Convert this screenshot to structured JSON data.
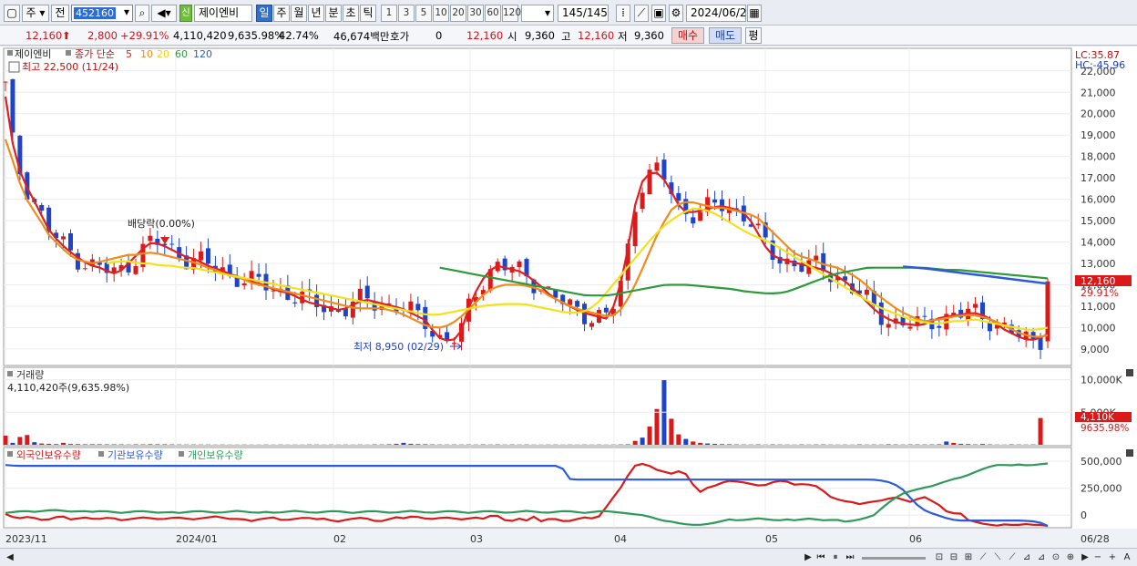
{
  "toolbar": {
    "period_week": "주",
    "prev_label": "전",
    "stock_code": "452160",
    "new_badge": "신",
    "stock_name": "제이엔비",
    "period_tabs": [
      "일",
      "주",
      "월",
      "년",
      "분",
      "초",
      "틱"
    ],
    "active_tab": "일",
    "intervals": [
      "1",
      "3",
      "5",
      "10",
      "20",
      "30",
      "60",
      "120"
    ],
    "count": "145/145",
    "date": "2024/06/28"
  },
  "quote": {
    "price": "12,160",
    "change": "2,800",
    "change_pct": "+29.91%",
    "volume": "4,110,420",
    "volume_ratio": "9,635.98%",
    "turnover": "42.74%",
    "amount": "46,674백만",
    "hoga_label": "호가",
    "hoga_value": "0",
    "hoga_price": "12,160",
    "open_label": "시",
    "open": "9,360",
    "high_label": "고",
    "high": "12,160",
    "low_label": "저",
    "low": "9,360",
    "buy": "매수",
    "sell": "매도",
    "eval": "평"
  },
  "price_panel": {
    "stock_label": "제이엔비",
    "ma_label": "종가 단순",
    "ma_periods": [
      "5",
      "10",
      "20",
      "60",
      "120"
    ],
    "ma_colors": [
      "#e02020",
      "#f08c1c",
      "#f0e21c",
      "#2d9a3a",
      "#2d5ad8"
    ],
    "high_note": "최고 22,500 (11/24)",
    "low_note": "최저 8,950 (02/29)",
    "dividend_note": "배당락(0.00%)",
    "lc": "LC:35.87",
    "hc": "HC:-45.96",
    "last_price_tag": "12,160",
    "last_pct_tag": "29.91%"
  },
  "volume_panel": {
    "title": "거래량",
    "summary": "4,110,420주(9,635.98%)",
    "tag_value": "4,110K",
    "tag_pct": "9635.98%"
  },
  "holding_panel": {
    "series": [
      "외국인보유수량",
      "기관보유수량",
      "개인보유수량"
    ],
    "colors": [
      "#d91a1a",
      "#2d5ad8",
      "#2e9a5a"
    ]
  },
  "x_axis_labels": [
    "2023/11",
    "2024/01",
    "02",
    "03",
    "04",
    "05",
    "06",
    "06/28"
  ],
  "chart_data": [
    {
      "type": "candlestick",
      "title": "제이엔비 일봉",
      "x": [
        "2023/11",
        "2024/01",
        "02",
        "03",
        "04",
        "05",
        "06"
      ],
      "y_ticks": [
        9000,
        10000,
        11000,
        12000,
        13000,
        14000,
        15000,
        16000,
        17000,
        18000,
        19000,
        20000,
        21000,
        22000
      ],
      "ylim": [
        8400,
        22800
      ],
      "series": [
        {
          "name": "5",
          "values": [
            20800,
            18200,
            16900,
            16200,
            15400,
            14600,
            14100,
            13700,
            13400,
            13100,
            12900,
            12800,
            12600,
            12500,
            12900,
            13300,
            13700,
            14000,
            13900,
            13700,
            13500,
            13300,
            13200,
            13000,
            12800,
            12700,
            12500,
            12400,
            12200,
            12100,
            12000,
            11800,
            11700,
            11600,
            11400,
            11200,
            11100,
            11000,
            10900,
            10800,
            11000,
            11200,
            11300,
            11200,
            11100,
            11000,
            10900,
            10700,
            10500,
            10300,
            9600,
            9400,
            9400,
            9900,
            11200,
            12000,
            12600,
            12900,
            12800,
            12700,
            12600,
            12300,
            12000,
            11600,
            11300,
            11100,
            10900,
            10700,
            10600,
            10500,
            10400,
            11400,
            13000,
            15600,
            16900,
            17300,
            17200,
            16600,
            15800,
            15400,
            15400,
            15500,
            15600,
            15700,
            15600,
            15500,
            15300,
            14700,
            13900,
            13400,
            13200,
            13100,
            13000,
            12900,
            12800,
            12700,
            12500,
            12300,
            12000,
            11600,
            11200,
            10800,
            10500,
            10300,
            10200,
            10150,
            10100,
            10200,
            10400,
            10500,
            10550,
            10600,
            10700,
            10650,
            10500,
            10200,
            9900,
            9700,
            9500,
            9400,
            9500,
            9700
          ]
        },
        {
          "name": "10",
          "values": [
            18800,
            17600,
            16300,
            15600,
            15000,
            14300,
            13900,
            13500,
            13200,
            13100,
            13000,
            13100,
            13200,
            13300,
            13400,
            13400,
            13500,
            13500,
            13400,
            13300,
            13200,
            13100,
            13000,
            12800,
            12700,
            12500,
            12400,
            12300,
            12100,
            12000,
            11900,
            11800,
            11700,
            11600,
            11500,
            11400,
            11300,
            11200,
            11100,
            11000,
            10900,
            10900,
            10900,
            10900,
            10800,
            10700,
            10500,
            10300,
            10100,
            10000,
            10000,
            10200,
            10500,
            10900,
            11300,
            11700,
            11900,
            12000,
            12000,
            12000,
            11900,
            11800,
            11500,
            11300,
            11100,
            10900,
            10800,
            10700,
            10600,
            10500,
            10700,
            11300,
            12100,
            13000,
            14000,
            14800,
            15500,
            15800,
            15900,
            15800,
            15700,
            15600,
            15600,
            15500,
            15400,
            15300,
            15100,
            14700,
            14300,
            13900,
            13500,
            13300,
            13200,
            13000,
            12900,
            12800,
            12600,
            12400,
            12100,
            11700,
            11400,
            11100,
            10800,
            10600,
            10400,
            10300,
            10350,
            10400,
            10500,
            10550,
            10600,
            10550,
            10450,
            10300,
            10100,
            9900,
            9700,
            9600,
            9550,
            9650
          ]
        },
        {
          "name": "20",
          "values": [
            13000,
            13100,
            13100,
            13000,
            13000,
            12900,
            12900,
            12800,
            12800,
            12700,
            12600,
            12500,
            12400,
            12300,
            12200,
            12100,
            12000,
            11900,
            11800,
            11700,
            11600,
            11500,
            11400,
            11300,
            11200,
            11100,
            11000,
            10900,
            10800,
            10700,
            10600,
            10600,
            10700,
            10800,
            10900,
            11000,
            11050,
            11100,
            11100,
            11100,
            11000,
            10900,
            10800,
            10700,
            10700,
            10800,
            11200,
            11800,
            12400,
            13000,
            13600,
            14200,
            14700,
            15100,
            15400,
            15600,
            15500,
            15300,
            15000,
            14700,
            14400,
            14200,
            14000,
            13700,
            13400,
            13100,
            12800,
            12500,
            12200,
            11900,
            11600,
            11300,
            11000,
            10800,
            10600,
            10400,
            10300,
            10200,
            10200,
            10300,
            10300,
            10400,
            10300,
            10200,
            10100,
            10000,
            9900,
            9900,
            10000
          ]
        },
        {
          "name": "60",
          "values": [
            12800,
            12700,
            12600,
            12500,
            12400,
            12300,
            12200,
            12100,
            12000,
            11900,
            11800,
            11700,
            11600,
            11500,
            11500,
            11500,
            11600,
            11700,
            11800,
            11900,
            12000,
            12000,
            12000,
            11950,
            11900,
            11850,
            11800,
            11700,
            11650,
            11600,
            11600,
            11700,
            11900,
            12100,
            12300,
            12500,
            12600,
            12700,
            12800,
            12800,
            12800,
            12800,
            12800,
            12800,
            12750,
            12700,
            12700,
            12650,
            12600,
            12550,
            12500,
            12450,
            12400,
            12350,
            12300
          ]
        },
        {
          "name": "120",
          "values": [
            12850,
            12820,
            12790,
            12750,
            12700,
            12650,
            12600,
            12550,
            12500,
            12450,
            12400,
            12350,
            12300,
            12250,
            12200,
            12150,
            12100,
            12060
          ]
        }
      ],
      "last_price": 12160,
      "high": {
        "value": 22500,
        "date": "11/24"
      },
      "low": {
        "value": 8950,
        "date": "02/29"
      }
    },
    {
      "type": "bar",
      "title": "거래량",
      "y_ticks": [
        "5,000K",
        "10,000K"
      ],
      "ylim": [
        0,
        10500
      ],
      "values_k": [
        1400,
        300,
        1200,
        1500,
        400,
        200,
        150,
        100,
        300,
        120,
        100,
        80,
        90,
        80,
        70,
        70,
        60,
        50,
        70,
        60,
        90,
        80,
        70,
        60,
        50,
        40,
        50,
        40,
        40,
        30,
        40,
        30,
        30,
        40,
        30,
        30,
        40,
        30,
        40,
        30,
        30,
        30,
        50,
        40,
        30,
        40,
        30,
        40,
        30,
        40,
        30,
        60,
        50,
        80,
        150,
        300,
        150,
        100,
        80,
        60,
        50,
        40,
        50,
        40,
        50,
        40,
        60,
        40,
        60,
        40,
        50,
        40,
        50,
        30,
        30,
        40,
        40,
        30,
        40,
        30,
        40,
        30,
        40,
        30,
        40,
        50,
        80,
        600,
        1100,
        2800,
        5500,
        10000,
        4000,
        1600,
        900,
        500,
        300,
        200,
        150,
        100,
        80,
        60,
        50,
        40,
        60,
        40,
        60,
        50,
        40,
        30,
        60,
        40,
        50,
        60,
        40,
        30,
        40,
        30,
        60,
        40,
        50,
        40,
        80,
        60,
        40,
        60,
        60,
        50,
        60,
        80,
        500,
        300,
        150,
        100,
        60,
        120,
        60,
        40,
        30,
        60,
        50,
        40,
        50,
        4110
      ]
    },
    {
      "type": "line",
      "title": "보유수량",
      "y_ticks": [
        "0",
        "250,000",
        "500,000"
      ],
      "ylim": [
        -100000,
        560000
      ],
      "series": [
        {
          "name": "외국인보유수량",
          "values": [
            10000,
            -20000,
            -30000,
            -10000,
            -40000,
            -50000,
            -20000,
            -10000,
            -40000,
            -30000,
            -20000,
            -40000,
            -30000,
            -20000,
            -50000,
            -40000,
            -30000,
            -20000,
            -30000,
            -40000,
            -30000,
            -20000,
            -30000,
            -40000,
            -30000,
            -20000,
            -10000,
            -30000,
            -40000,
            -30000,
            -60000,
            -40000,
            -30000,
            -20000,
            -50000,
            -40000,
            -30000,
            -20000,
            -40000,
            -30000,
            -50000,
            -60000,
            -40000,
            -30000,
            -20000,
            -50000,
            -60000,
            -40000,
            -20000,
            -30000,
            -10000,
            -20000,
            -40000,
            -30000,
            -20000,
            -30000,
            -40000,
            -30000,
            -20000,
            -40000,
            20000,
            -40000,
            -60000,
            -30000,
            -50000,
            -10000,
            -70000,
            -20000,
            -50000,
            -60000,
            -40000,
            -20000,
            -30000,
            -10000,
            100000,
            200000,
            300000,
            450000,
            480000,
            460000,
            420000,
            400000,
            380000,
            420000,
            350000,
            200000,
            250000,
            270000,
            300000,
            320000,
            310000,
            300000,
            280000,
            270000,
            300000,
            320000,
            310000,
            280000,
            290000,
            280000,
            260000,
            180000,
            150000,
            130000,
            120000,
            100000,
            120000,
            130000,
            140000,
            170000,
            150000,
            120000,
            150000,
            170000,
            120000,
            80000,
            0,
            40000,
            -40000,
            -60000,
            -80000,
            -90000,
            -100000,
            -80000,
            -100000,
            -80000,
            -90000,
            -90000,
            -100000
          ]
        },
        {
          "name": "기관보유수량",
          "values": [
            465000,
            458000,
            458000,
            458000,
            458000,
            458000,
            458000,
            458000,
            458000,
            458000,
            458000,
            458000,
            458000,
            458000,
            458000,
            458000,
            458000,
            458000,
            458000,
            458000,
            458000,
            458000,
            458000,
            458000,
            458000,
            458000,
            458000,
            458000,
            458000,
            458000,
            458000,
            458000,
            458000,
            458000,
            458000,
            458000,
            458000,
            458000,
            458000,
            458000,
            458000,
            458000,
            458000,
            458000,
            458000,
            458000,
            458000,
            458000,
            458000,
            458000,
            458000,
            458000,
            458000,
            458000,
            458000,
            458000,
            458000,
            458000,
            330000,
            330000,
            330000,
            330000,
            330000,
            330000,
            330000,
            330000,
            330000,
            330000,
            330000,
            330000,
            330000,
            330000,
            330000,
            330000,
            330000,
            330000,
            330000,
            330000,
            330000,
            330000,
            330000,
            330000,
            330000,
            330000,
            330000,
            330000,
            330000,
            330000,
            330000,
            330000,
            320000,
            300000,
            250000,
            150000,
            60000,
            20000,
            -10000,
            -40000,
            -50000,
            -50000,
            -50000,
            -50000,
            -50000,
            -50000,
            -50000,
            -55000,
            -60000,
            -100000
          ]
        },
        {
          "name": "개인보유수량",
          "values": [
            20000,
            30000,
            40000,
            30000,
            40000,
            50000,
            40000,
            30000,
            40000,
            30000,
            40000,
            30000,
            20000,
            30000,
            40000,
            30000,
            20000,
            30000,
            20000,
            30000,
            40000,
            30000,
            20000,
            30000,
            40000,
            30000,
            20000,
            30000,
            20000,
            30000,
            40000,
            30000,
            20000,
            30000,
            40000,
            30000,
            20000,
            30000,
            40000,
            30000,
            20000,
            30000,
            40000,
            30000,
            20000,
            30000,
            40000,
            30000,
            20000,
            30000,
            40000,
            30000,
            20000,
            30000,
            40000,
            30000,
            20000,
            30000,
            40000,
            30000,
            20000,
            30000,
            40000,
            30000,
            20000,
            10000,
            0,
            -20000,
            -50000,
            -60000,
            -80000,
            -90000,
            -90000,
            -80000,
            -60000,
            -40000,
            -50000,
            -40000,
            -30000,
            -40000,
            -50000,
            -40000,
            -50000,
            -30000,
            -40000,
            -50000,
            -40000,
            -60000,
            -50000,
            -30000,
            0,
            80000,
            150000,
            200000,
            230000,
            250000,
            270000,
            300000,
            330000,
            350000,
            380000,
            420000,
            450000,
            470000,
            460000,
            470000,
            460000,
            470000,
            480000
          ]
        }
      ]
    }
  ]
}
